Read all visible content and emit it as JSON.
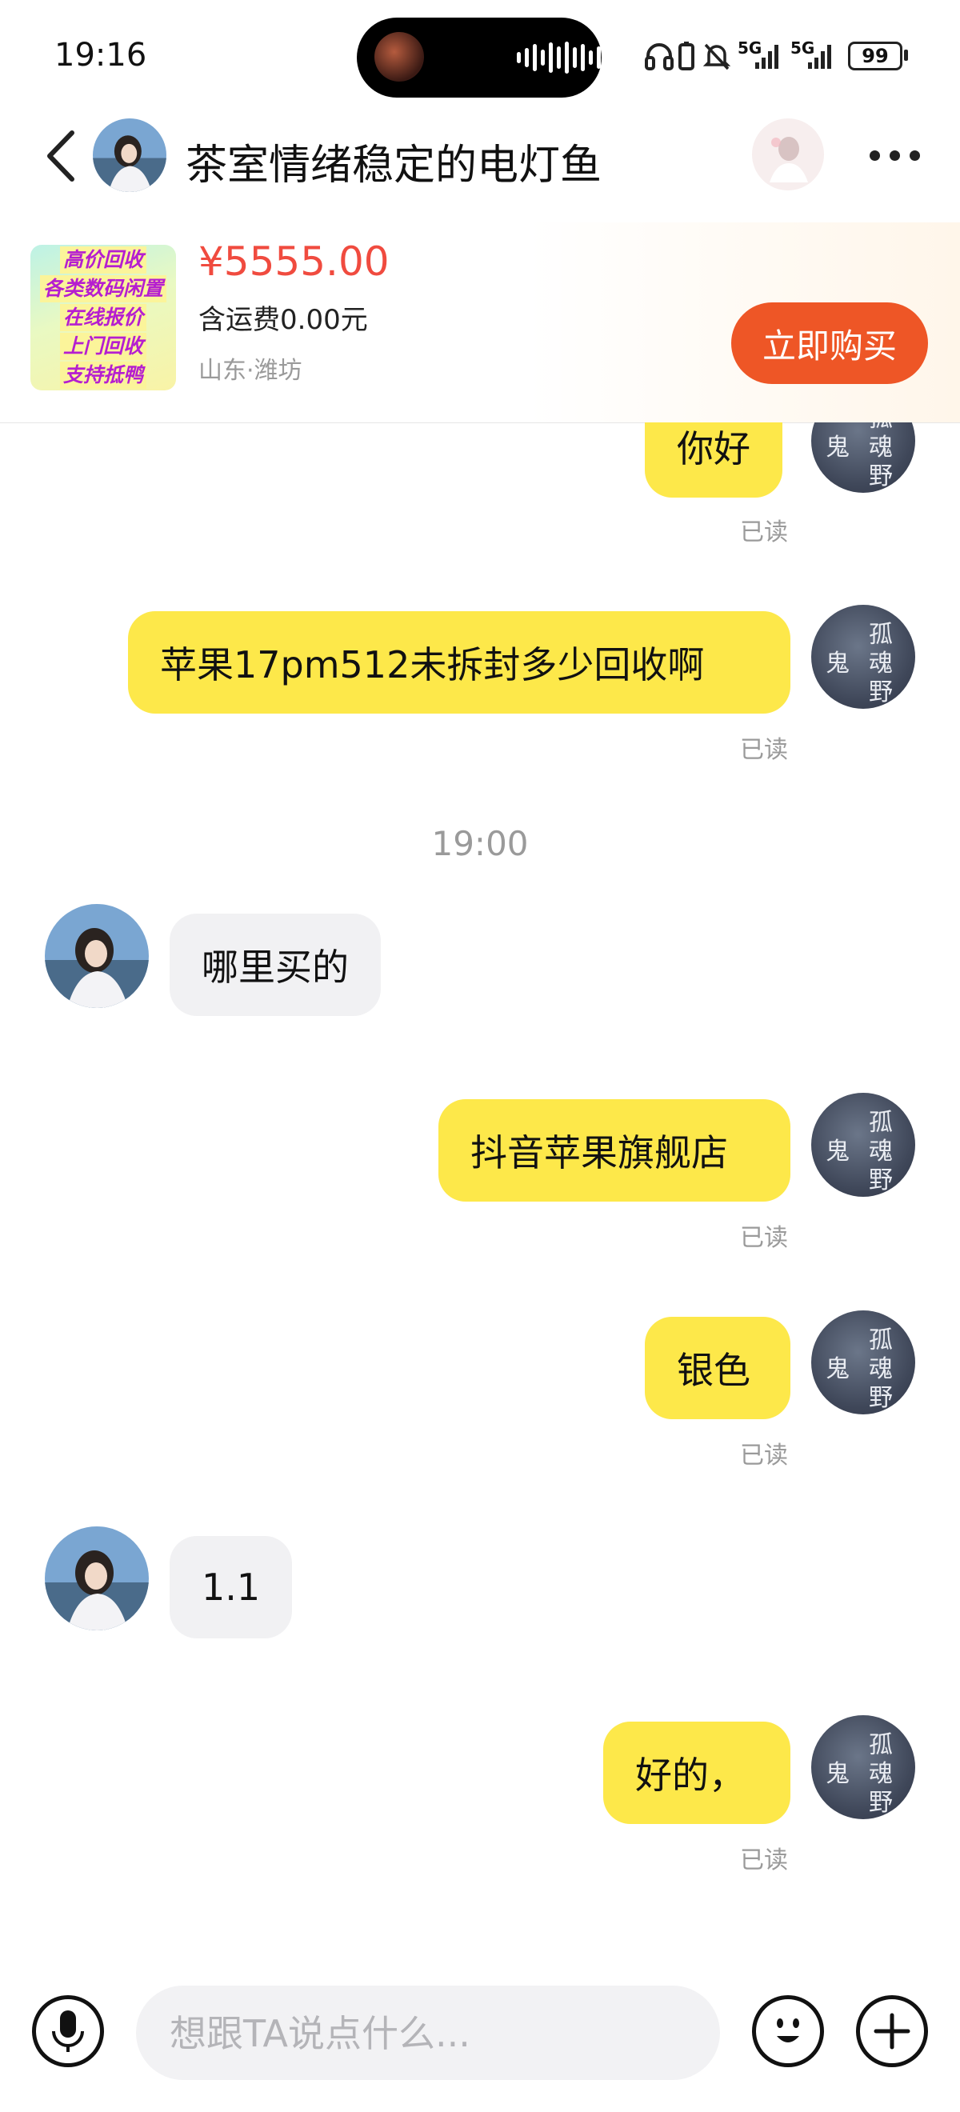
{
  "status_bar": {
    "time": "19:16",
    "battery": "99",
    "network_1": "5G",
    "network_2": "5G",
    "icons": [
      "headphones-icon",
      "vibrate-icon",
      "mute-icon",
      "signal-icon",
      "signal-icon",
      "battery-icon"
    ]
  },
  "header": {
    "title": "茶室情绪稳定的电灯鱼",
    "back_icon": "chevron-left-icon",
    "more_icon": "more-dots-icon"
  },
  "product": {
    "thumbnail_lines": [
      "高价回收",
      "各类数码闲置",
      "在线报价",
      "上门回收",
      "支持抵鸭"
    ],
    "price": "¥5555.00",
    "shipping": "含运费0.00元",
    "location": "山东·潍坊",
    "buy_label": "立即购买"
  },
  "my_avatar_text": [
    "孤",
    "鬼",
    "魂",
    "野"
  ],
  "messages": [
    {
      "from": "me",
      "text": "你好",
      "status": "已读"
    },
    {
      "from": "me",
      "text": "苹果17pm512未拆封多少回收啊",
      "status": "已读"
    },
    {
      "type": "time",
      "text": "19:00"
    },
    {
      "from": "them",
      "text": "哪里买的"
    },
    {
      "from": "me",
      "text": "抖音苹果旗舰店",
      "status": "已读"
    },
    {
      "from": "me",
      "text": "银色",
      "status": "已读"
    },
    {
      "from": "them",
      "text": "1.1"
    },
    {
      "from": "me",
      "text": "好的，",
      "status": "已读"
    }
  ],
  "input_bar": {
    "placeholder": "想跟TA说点什么...",
    "mic_icon": "microphone-icon",
    "emoji_icon": "emoji-icon",
    "plus_icon": "plus-icon"
  },
  "colors": {
    "my_bubble": "#fde84a",
    "their_bubble": "#f1f1f3",
    "price": "#f04b3f",
    "buy_button": "#ee5626",
    "read_text": "#9a9a9a"
  }
}
